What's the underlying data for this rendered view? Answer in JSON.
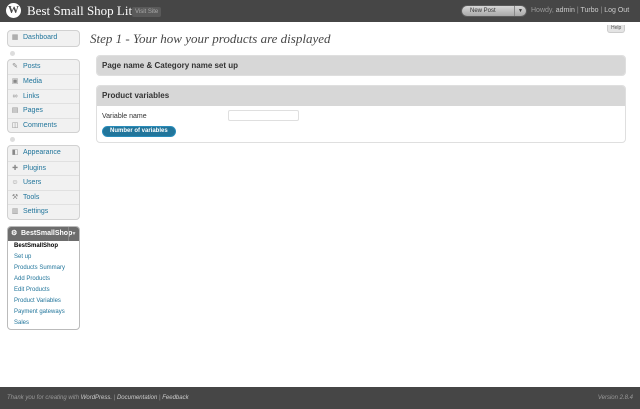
{
  "header": {
    "site_title": "Best Small Shop Lite",
    "visit_site": "Visit Site",
    "new_post": "New Post",
    "howdy": "Howdy,",
    "user": "admin",
    "turbo": "Turbo",
    "logout": "Log Out",
    "sep": "|"
  },
  "help_tab": "Help",
  "menu": {
    "dashboard": "Dashboard",
    "posts": "Posts",
    "media": "Media",
    "links": "Links",
    "pages": "Pages",
    "comments": "Comments",
    "appearance": "Appearance",
    "plugins": "Plugins",
    "users": "Users",
    "tools": "Tools",
    "settings": "Settings",
    "bss": {
      "title": "BestSmallShop",
      "items": [
        "BestSmallShop",
        "Set up",
        "Products Summary",
        "Add Products",
        "Edit Products",
        "Product Variables",
        "Payment gateways",
        "Sales"
      ]
    }
  },
  "main": {
    "page_title": "Step 1 - Your how your products are displayed",
    "box1_title": "Page name & Category name set up",
    "box2_title": "Product variables",
    "variable_label": "Variable name",
    "variable_value": "",
    "button": "Number of variables"
  },
  "footer": {
    "thanks": "Thank you for creating with",
    "wordpress": "WordPress.",
    "documentation": "Documentation",
    "feedback": "Feedback",
    "sep": "|",
    "version": "Version 2.8.4"
  },
  "colors": {
    "header": "#464646",
    "link": "#21759b",
    "button": "#21759b",
    "box_header": "#d7d7d7"
  }
}
